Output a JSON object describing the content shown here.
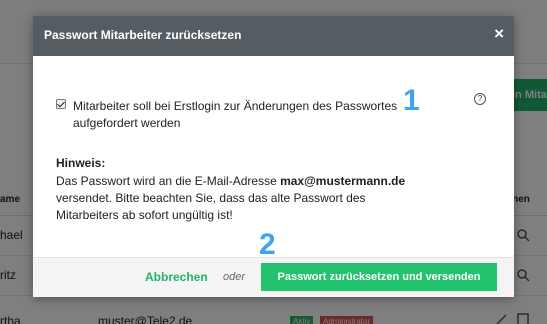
{
  "background": {
    "green_button_label": "en Mitar",
    "table": {
      "col_name": "ame",
      "col_actions": "onen",
      "rows": [
        {
          "name": "hael",
          "email": ""
        },
        {
          "name": "ritz",
          "email": ""
        },
        {
          "name": "rtha",
          "email": "muster@Tele2.de",
          "badges": [
            "Aktiv",
            "Administrator"
          ]
        }
      ]
    }
  },
  "modal": {
    "title": "Passwort Mitarbeiter zurücksetzen",
    "close_symbol": "×",
    "checkbox_label": "Mitarbeiter soll bei Erstlogin zur Änderungen des Passwortes aufgefordert werden",
    "checkbox_checked": true,
    "help_symbol": "?",
    "marker_1": "1",
    "marker_2": "2",
    "hint_title": "Hinweis:",
    "hint_prefix": "Das Passwort wird an die E-Mail-Adresse ",
    "hint_email": "max@mustermann.de",
    "hint_suffix": " versendet. Bitte beachten Sie, dass das alte Passwort des Mitarbeiters ab sofort ungültig ist!",
    "cancel_label": "Abbrechen",
    "or_label": "oder",
    "submit_label": "Passwort zurücksetzen und versenden"
  },
  "colors": {
    "header_bg": "#555d63",
    "accent_green": "#22c26e",
    "marker_blue": "#3fa3f2"
  }
}
